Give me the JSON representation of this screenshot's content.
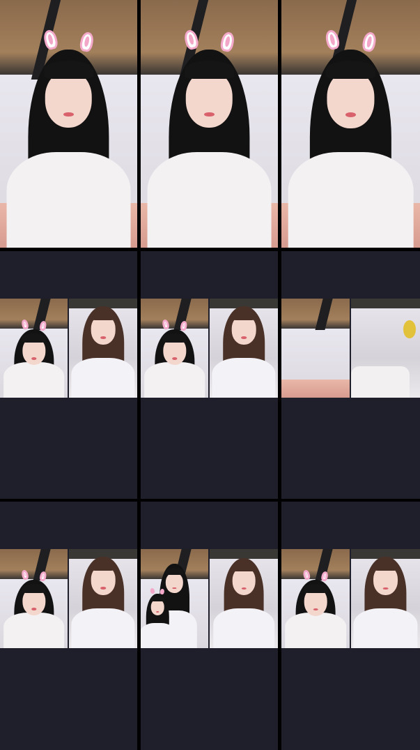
{
  "layout": {
    "rows": 3,
    "cols": 3
  },
  "cells": [
    {
      "row": 0,
      "col": 0,
      "kind": "single",
      "bunny_ears": true
    },
    {
      "row": 0,
      "col": 1,
      "kind": "single",
      "bunny_ears": true
    },
    {
      "row": 0,
      "col": 2,
      "kind": "single",
      "bunny_ears": true
    },
    {
      "row": 1,
      "col": 0,
      "kind": "split",
      "bunny_ears_left": true,
      "bunny_ears_right": false
    },
    {
      "row": 1,
      "col": 1,
      "kind": "split",
      "bunny_ears_left": true,
      "bunny_ears_right": false
    },
    {
      "row": 1,
      "col": 2,
      "kind": "split-empty",
      "bunny_ears_left": false,
      "bunny_ears_right": false
    },
    {
      "row": 2,
      "col": 0,
      "kind": "split",
      "bunny_ears_left": true,
      "bunny_ears_right": false
    },
    {
      "row": 2,
      "col": 1,
      "kind": "split-group",
      "bunny_ears_left": true,
      "bunny_ears_right": false
    },
    {
      "row": 2,
      "col": 2,
      "kind": "split",
      "bunny_ears_left": true,
      "bunny_ears_right": false
    }
  ],
  "colors": {
    "background": "#000000",
    "panel": "#1e1f2b",
    "ear_pink": "#f2a6c8"
  }
}
